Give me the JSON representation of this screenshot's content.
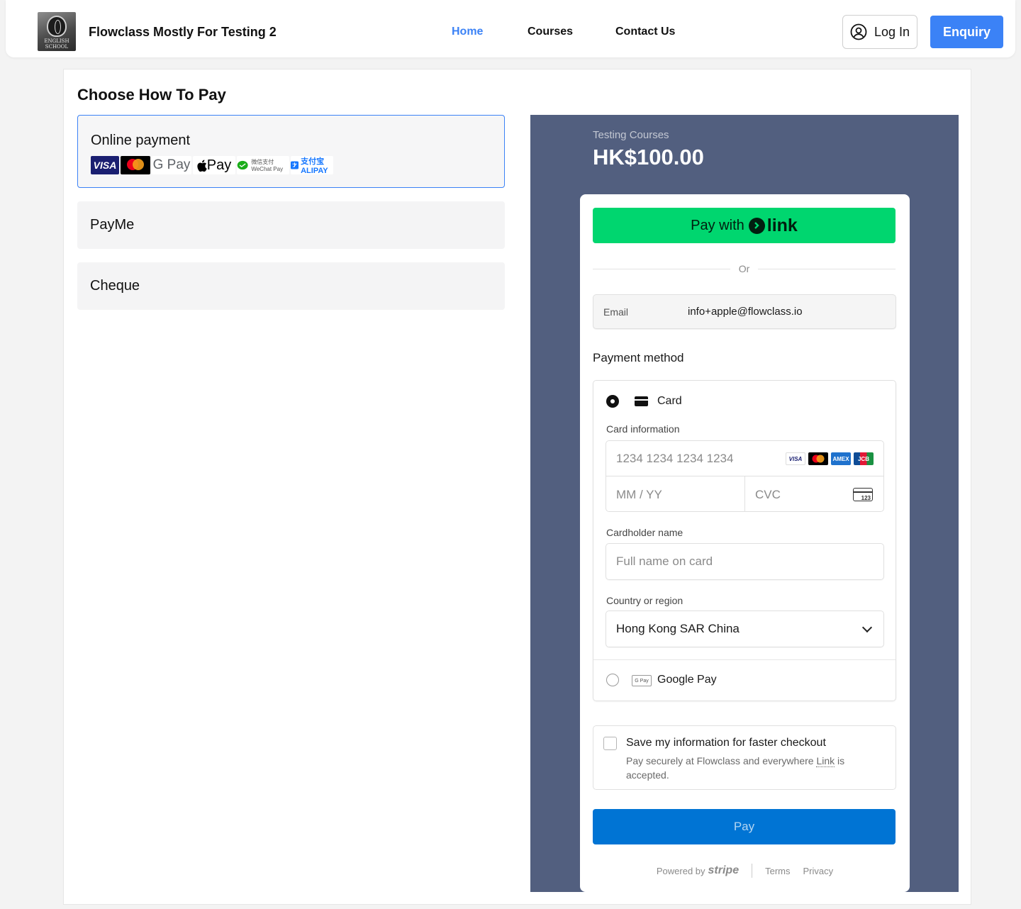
{
  "header": {
    "logo_text": "ENGLISH SCHOOL",
    "site_title": "Flowclass Mostly For Testing 2",
    "nav": [
      {
        "label": "Home",
        "active": true
      },
      {
        "label": "Courses",
        "active": false
      },
      {
        "label": "Contact Us",
        "active": false
      }
    ],
    "login_label": "Log In",
    "enquiry_label": "Enquiry",
    "accent_color": "#3b82f6"
  },
  "page": {
    "title": "Choose How To Pay",
    "options": [
      {
        "label": "Online payment",
        "selected": true,
        "logos": [
          "VISA",
          "mastercard",
          "G Pay",
          "Pay",
          "微信支付 WeChat Pay",
          "支付宝 ALIPAY"
        ]
      },
      {
        "label": "PayMe",
        "selected": false
      },
      {
        "label": "Cheque",
        "selected": false
      }
    ]
  },
  "checkout": {
    "course_name": "Testing Courses",
    "amount": "HK$100.00",
    "panel_color": "#525f7f",
    "link_button": {
      "prefix": "Pay with",
      "brand": "link",
      "color": "#00d66f"
    },
    "divider_text": "Or",
    "email": {
      "label": "Email",
      "value": "info+apple@flowclass.io"
    },
    "payment_method_title": "Payment method",
    "methods": {
      "card": {
        "label": "Card",
        "selected": true
      },
      "google_pay": {
        "label": "Google Pay",
        "selected": false,
        "icon_text": "G Pay"
      }
    },
    "card_information_label": "Card information",
    "card_number_placeholder": "1234 1234 1234 1234",
    "card_brands": [
      "VISA",
      "mastercard",
      "AMEX",
      "JCB"
    ],
    "expiry_placeholder": "MM / YY",
    "cvc_placeholder": "CVC",
    "cardholder_label": "Cardholder name",
    "cardholder_placeholder": "Full name on card",
    "country_label": "Country or region",
    "country_value": "Hong Kong SAR China",
    "save_info": {
      "title": "Save my information for faster checkout",
      "desc_prefix": "Pay securely at Flowclass and everywhere",
      "desc_link": "Link",
      "desc_suffix": "is accepted.",
      "checked": false
    },
    "pay_button_label": "Pay",
    "pay_button_color": "#0074d4",
    "footer": {
      "powered_by": "Powered by",
      "brand": "stripe",
      "terms": "Terms",
      "privacy": "Privacy"
    }
  }
}
